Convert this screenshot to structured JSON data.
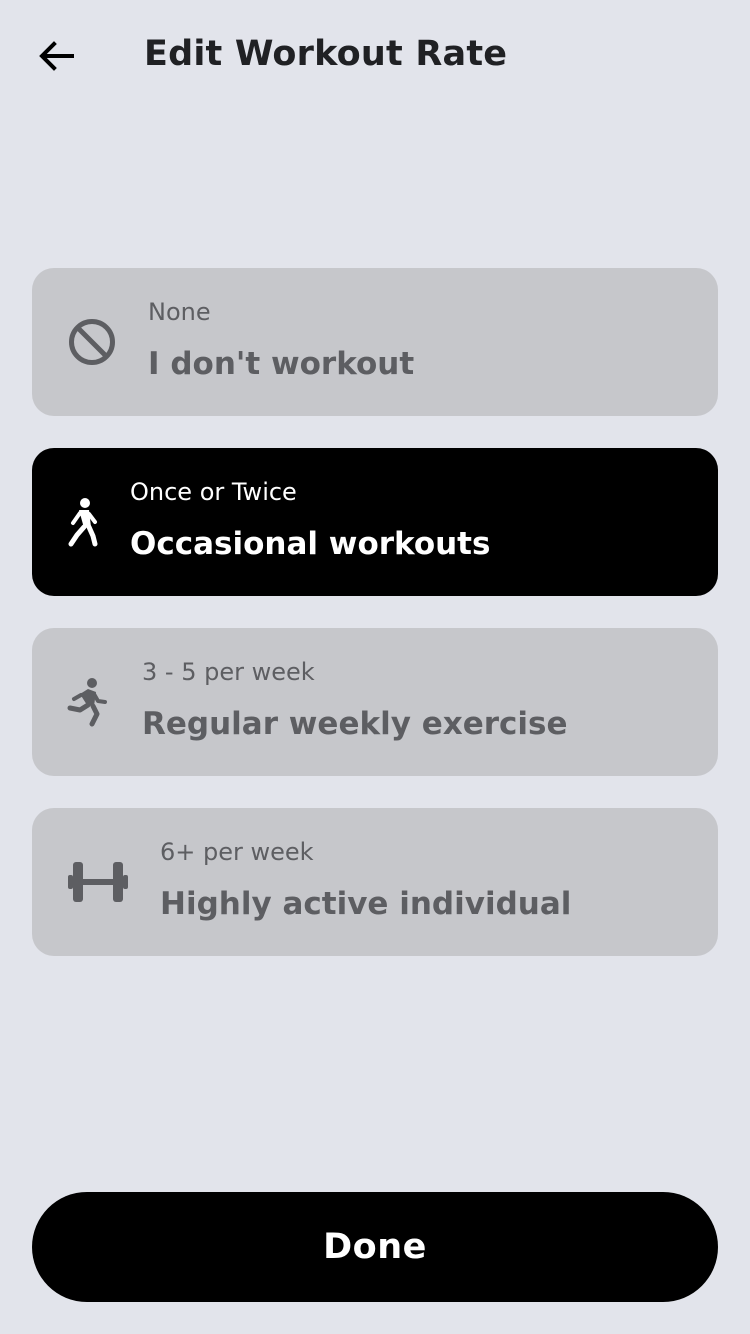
{
  "header": {
    "back_icon": "arrow-left-icon",
    "title": "Edit Workout Rate"
  },
  "options": [
    {
      "icon": "no-symbol-icon",
      "sub": "None",
      "main": "I don't workout",
      "selected": false
    },
    {
      "icon": "walking-person-icon",
      "sub": "Once or Twice",
      "main": "Occasional workouts",
      "selected": true
    },
    {
      "icon": "running-person-icon",
      "sub": "3 - 5 per week",
      "main": "Regular weekly exercise",
      "selected": false
    },
    {
      "icon": "dumbbell-icon",
      "sub": "6+ per week",
      "main": "Highly active individual",
      "selected": false
    }
  ],
  "done_button": {
    "label": "Done"
  },
  "colors": {
    "background": "#e2e4eb",
    "option_bg": "#c6c7cb",
    "option_text": "#5d5e62",
    "selected_bg": "#000000",
    "selected_text": "#ffffff"
  }
}
